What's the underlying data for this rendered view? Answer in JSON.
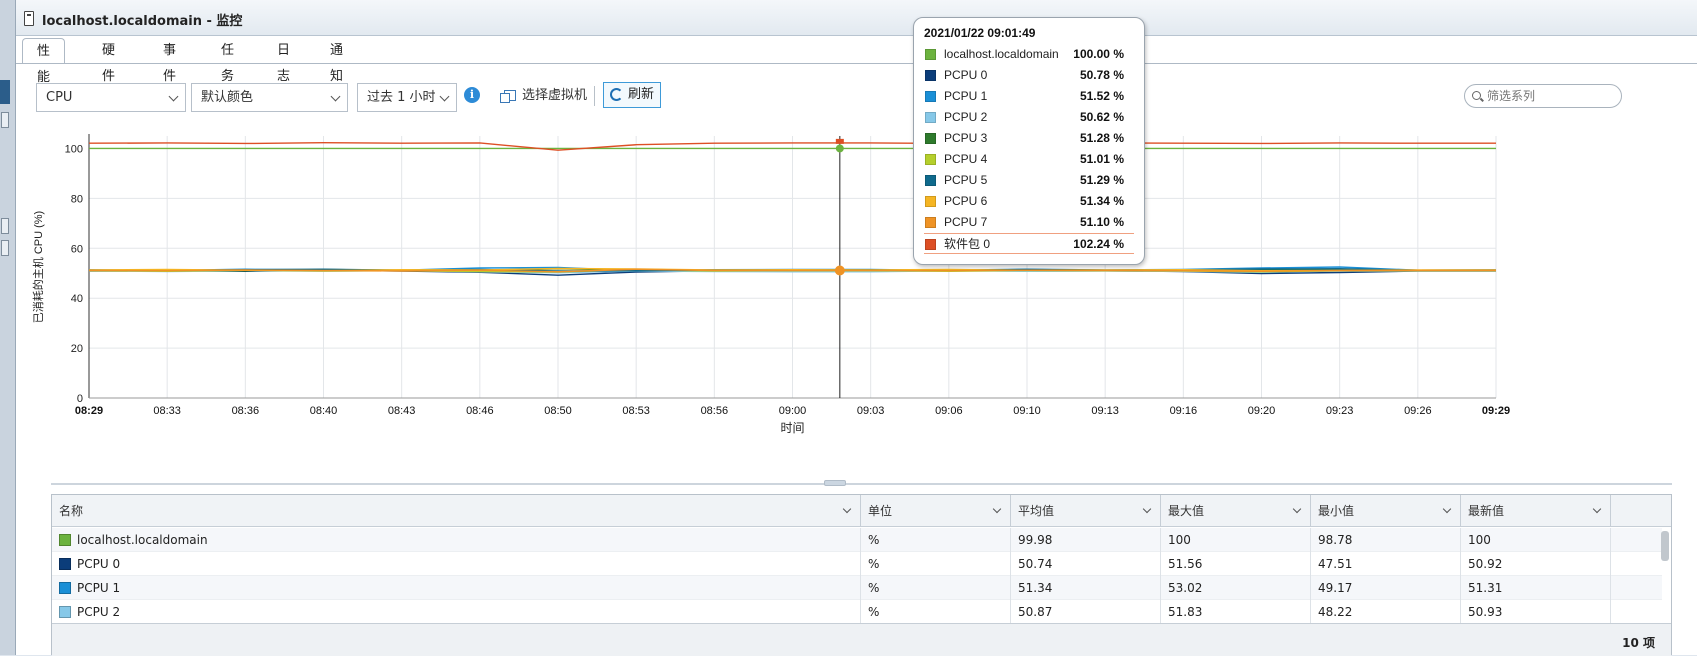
{
  "window": {
    "title": "localhost.localdomain - 监控"
  },
  "tabs": [
    {
      "label": "性能",
      "active": true
    },
    {
      "label": "硬件",
      "active": false
    },
    {
      "label": "事件",
      "active": false
    },
    {
      "label": "任务",
      "active": false
    },
    {
      "label": "日志",
      "active": false
    },
    {
      "label": "通知",
      "active": false
    }
  ],
  "toolbar": {
    "metric_value": "CPU",
    "color_value": "默认颜色",
    "range_value": "过去 1 小时",
    "select_vm_label": "选择虚拟机",
    "refresh_label": "刷新",
    "filter_placeholder": "筛选系列"
  },
  "tooltip": {
    "datetime": "2021/01/22 09:01:49",
    "rows": [
      {
        "name": "localhost.localdomain",
        "value": "100.00 %",
        "color": "#6cb33f"
      },
      {
        "name": "PCPU 0",
        "value": "50.78 %",
        "color": "#0b3d7a"
      },
      {
        "name": "PCPU 1",
        "value": "51.52 %",
        "color": "#1a8fd6"
      },
      {
        "name": "PCPU 2",
        "value": "50.62 %",
        "color": "#86c8e8"
      },
      {
        "name": "PCPU 3",
        "value": "51.28 %",
        "color": "#2e7a2c"
      },
      {
        "name": "PCPU 4",
        "value": "51.01 %",
        "color": "#b5cf2c"
      },
      {
        "name": "PCPU 5",
        "value": "51.29 %",
        "color": "#0f6a8c"
      },
      {
        "name": "PCPU 6",
        "value": "51.34 %",
        "color": "#f5b523"
      },
      {
        "name": "PCPU 7",
        "value": "51.10 %",
        "color": "#ef9325"
      },
      {
        "name": "软件包 0",
        "value": "102.24 %",
        "color": "#dd4f25"
      }
    ]
  },
  "chart_data": {
    "type": "line",
    "ylabel": "已消耗的主机 CPU (%)",
    "xlabel": "时间",
    "ylim": [
      0,
      105
    ],
    "y_ticks": [
      0,
      20,
      40,
      60,
      80,
      100
    ],
    "x_tick_labels": [
      "08:29",
      "08:33",
      "08:36",
      "08:40",
      "08:43",
      "08:46",
      "08:50",
      "08:53",
      "08:56",
      "09:00",
      "09:03",
      "09:06",
      "09:10",
      "09:13",
      "09:16",
      "09:20",
      "09:23",
      "09:26",
      "09:29"
    ],
    "grid": true,
    "cursor_time": "09:01:49",
    "series": [
      {
        "name": "localhost.localdomain",
        "color": "#6cb33f",
        "values": [
          100,
          100,
          100,
          100,
          100,
          100,
          100,
          100,
          100,
          100,
          100,
          100,
          100,
          100,
          100,
          100,
          100,
          100,
          100
        ]
      },
      {
        "name": "软件包 0",
        "color": "#dd4f25",
        "values": [
          102.1,
          102.2,
          102.0,
          102.3,
          102.1,
          102.2,
          99.3,
          101.5,
          102.1,
          102.2,
          102.2,
          102.0,
          102.3,
          102.2,
          102.1,
          102.0,
          102.2,
          102.1,
          102.1
        ]
      },
      {
        "name": "PCPU 0",
        "color": "#0b3d7a",
        "values": [
          50.9,
          51.0,
          50.8,
          51.2,
          50.9,
          50.4,
          49.2,
          50.5,
          51.0,
          50.9,
          50.8,
          51.1,
          50.9,
          51.0,
          50.7,
          49.9,
          50.3,
          50.9,
          50.9
        ]
      },
      {
        "name": "PCPU 1",
        "color": "#1a8fd6",
        "values": [
          51.3,
          51.1,
          51.6,
          51.4,
          51.2,
          52.1,
          52.3,
          51.0,
          51.4,
          51.5,
          51.5,
          51.2,
          51.6,
          51.3,
          51.5,
          52.1,
          52.5,
          51.2,
          51.3
        ]
      },
      {
        "name": "PCPU 2",
        "color": "#86c8e8",
        "values": [
          50.9,
          50.7,
          51.0,
          50.8,
          51.1,
          50.6,
          50.2,
          50.9,
          50.7,
          50.6,
          50.6,
          51.0,
          50.8,
          50.9,
          50.8,
          50.4,
          50.9,
          50.9,
          50.9
        ]
      },
      {
        "name": "PCPU 3",
        "color": "#2e7a2c",
        "values": [
          51.1,
          51.3,
          51.0,
          51.5,
          51.2,
          51.0,
          51.8,
          51.3,
          51.1,
          51.3,
          51.3,
          51.0,
          51.4,
          51.2,
          51.1,
          51.6,
          51.2,
          51.1,
          51.2
        ]
      },
      {
        "name": "PCPU 4",
        "color": "#b5cf2c",
        "values": [
          51.0,
          50.8,
          51.2,
          50.9,
          51.0,
          50.7,
          50.5,
          51.4,
          50.9,
          51.0,
          51.0,
          50.8,
          51.1,
          51.0,
          50.9,
          50.6,
          51.0,
          51.0,
          51.0
        ]
      },
      {
        "name": "PCPU 5",
        "color": "#0f6a8c",
        "values": [
          51.3,
          51.1,
          51.4,
          51.6,
          51.2,
          51.5,
          50.9,
          51.0,
          51.3,
          51.3,
          51.3,
          51.1,
          51.5,
          51.2,
          51.3,
          51.7,
          51.8,
          51.2,
          51.3
        ]
      },
      {
        "name": "PCPU 6",
        "color": "#f5b523",
        "values": [
          51.3,
          51.5,
          51.2,
          51.0,
          51.4,
          51.3,
          51.9,
          51.7,
          51.3,
          51.4,
          51.3,
          51.5,
          51.2,
          51.3,
          51.4,
          51.0,
          51.1,
          51.3,
          51.3
        ]
      },
      {
        "name": "PCPU 7",
        "color": "#ef9325",
        "values": [
          51.1,
          51.0,
          51.3,
          51.1,
          50.9,
          51.2,
          50.6,
          51.6,
          51.1,
          51.1,
          51.1,
          51.0,
          51.2,
          51.1,
          51.0,
          50.8,
          51.1,
          51.1,
          51.1
        ]
      }
    ]
  },
  "table": {
    "columns": [
      "名称",
      "单位",
      "平均值",
      "最大值",
      "最小值",
      "最新值"
    ],
    "rows": [
      {
        "name": "localhost.localdomain",
        "color": "#6cb33f",
        "unit": "%",
        "avg": "99.98",
        "max": "100",
        "min": "98.78",
        "latest": "100"
      },
      {
        "name": "PCPU 0",
        "color": "#0b3d7a",
        "unit": "%",
        "avg": "50.74",
        "max": "51.56",
        "min": "47.51",
        "latest": "50.92"
      },
      {
        "name": "PCPU 1",
        "color": "#1a8fd6",
        "unit": "%",
        "avg": "51.34",
        "max": "53.02",
        "min": "49.17",
        "latest": "51.31"
      },
      {
        "name": "PCPU 2",
        "color": "#86c8e8",
        "unit": "%",
        "avg": "50.87",
        "max": "51.83",
        "min": "48.22",
        "latest": "50.93"
      }
    ],
    "count_label": "10 项"
  }
}
